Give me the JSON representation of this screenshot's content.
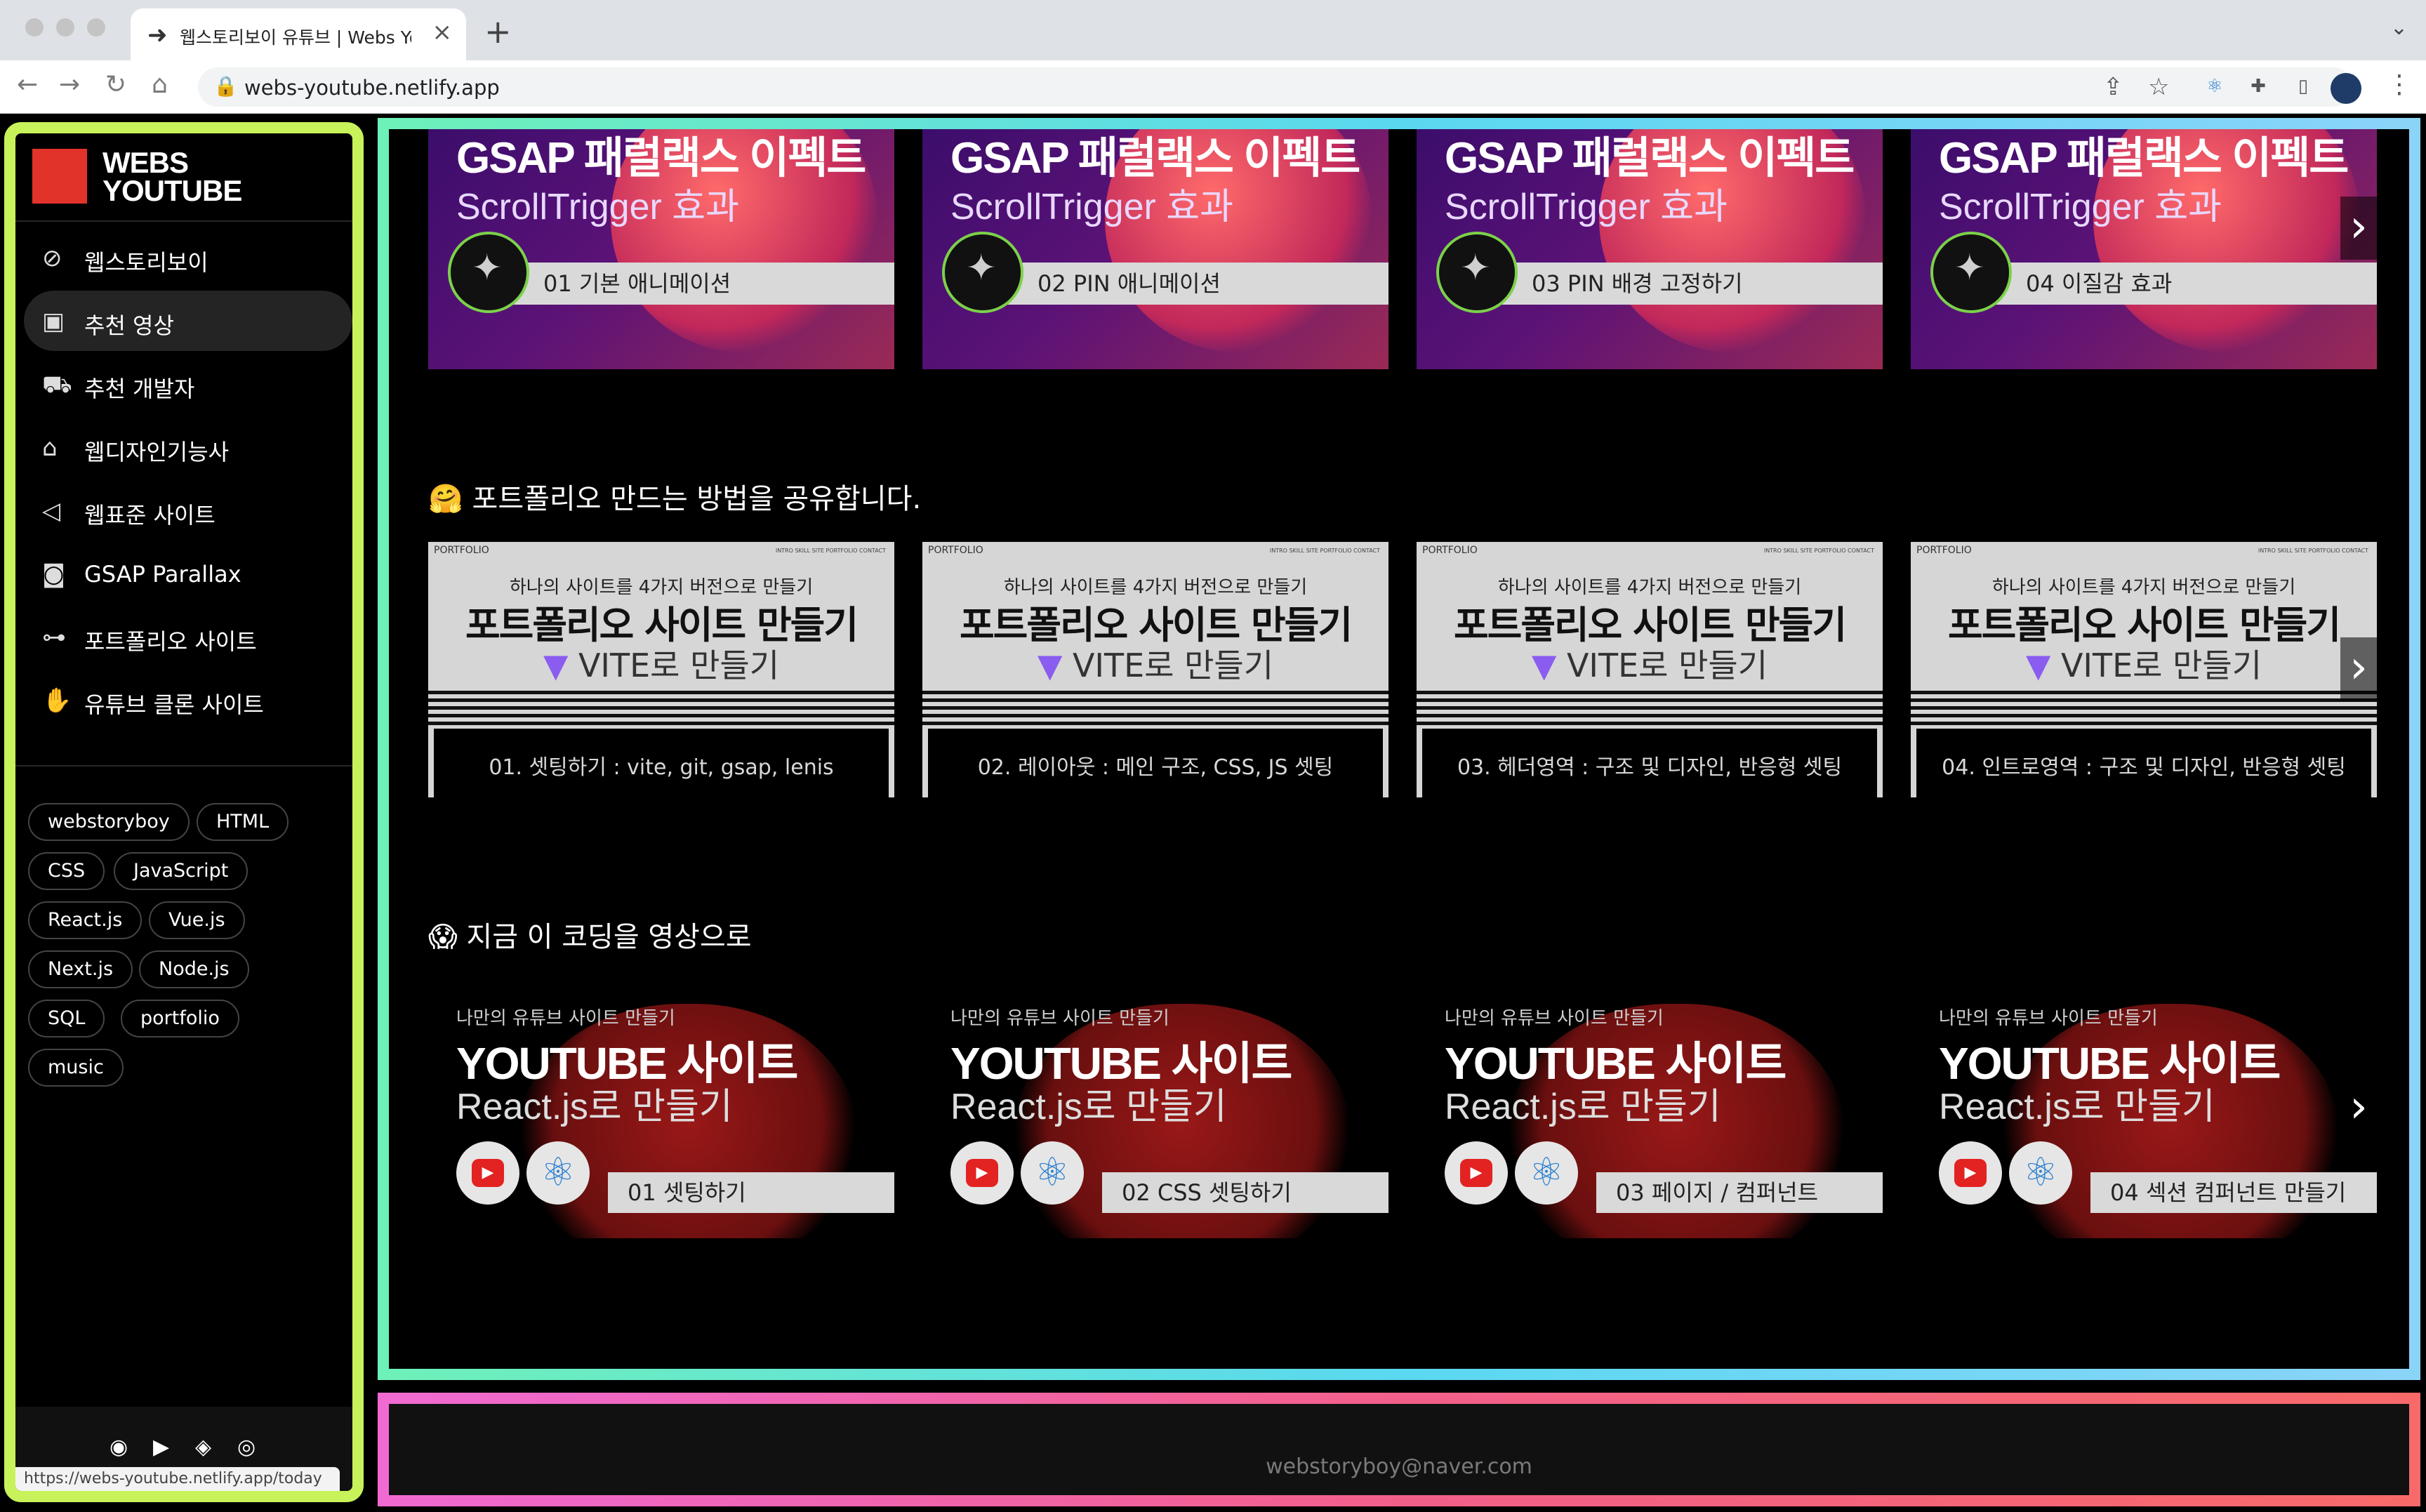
{
  "browser": {
    "tab_title": "웹스토리보이 유튜브 | Webs Youtube",
    "url": "webs-youtube.netlify.app"
  },
  "sidebar": {
    "logo_line1": "WEBS",
    "logo_line2": "YOUTUBE",
    "menu": [
      {
        "label": "웹스토리보이",
        "icon": "compass-icon"
      },
      {
        "label": "추천 영상",
        "icon": "video-icon"
      },
      {
        "label": "추천 개발자",
        "icon": "truck-icon"
      },
      {
        "label": "웹디자인기능사",
        "icon": "building-icon"
      },
      {
        "label": "웹표준 사이트",
        "icon": "megaphone-icon"
      },
      {
        "label": "GSAP Parallax",
        "icon": "cup-icon"
      },
      {
        "label": "포트폴리오 사이트",
        "icon": "dumbbell-icon"
      },
      {
        "label": "유튜브 클론 사이트",
        "icon": "hand-icon"
      }
    ],
    "tags": [
      "webstoryboy",
      "HTML",
      "CSS",
      "JavaScript",
      "React.js",
      "Vue.js",
      "Next.js",
      "Node.js",
      "SQL",
      "portfolio",
      "music"
    ],
    "status_url": "https://webs-youtube.netlify.app/today"
  },
  "sections": {
    "gsap": {
      "headline": "GSAP 패럴랙스 이펙트",
      "subline": "ScrollTrigger 효과",
      "items": [
        "01 기본 애니메이션",
        "02 PIN 애니메이션",
        "03 PIN 배경 고정하기",
        "04 이질감 효과"
      ]
    },
    "portfolio": {
      "title": "🤗 포트폴리오 만드는 방법을 공유합니다.",
      "nav_brand": "PORTFOLIO",
      "nav_links": "INTRO  SKILL  SITE  PORTFOLIO  CONTACT",
      "sub": "하나의 사이트를 4가지 버전으로 만들기",
      "headline": "포트폴리오 사이트 만들기",
      "subline": "VITE로 만들기",
      "items": [
        "01. 셋팅하기 : vite, git, gsap, lenis",
        "02. 레이아웃 : 메인 구조, CSS, JS 셋팅",
        "03. 헤더영역 : 구조 및 디자인, 반응형 셋팅",
        "04. 인트로영역 : 구조 및 디자인, 반응형 셋팅"
      ]
    },
    "youtube": {
      "title": "😱 지금 이 코딩을 영상으로",
      "small": "나만의 유튜브 사이트 만들기",
      "headline": "YOUTUBE 사이트",
      "subline": "React.js로 만들기",
      "items": [
        "01 셋팅하기",
        "02 CSS 셋팅하기",
        "03 페이지 / 컴퍼넌트",
        "04 섹션 컴퍼넌트 만들기"
      ]
    }
  },
  "footer": {
    "email": "webstoryboy@naver.com"
  },
  "colors": {
    "sidebar_border": "#c8f25a",
    "main_border": "#6ef0b9",
    "footer_border": "#f2608a",
    "logo_red": "#e2332a"
  }
}
